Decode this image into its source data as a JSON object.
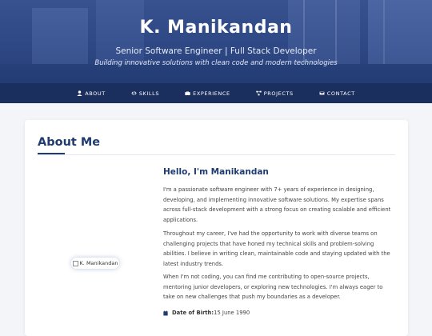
{
  "header": {
    "name": "K. Manikandan",
    "subtitle": "Senior Software Engineer | Full Stack Developer",
    "tagline": "Building innovative solutions with clean code and modern technologies"
  },
  "nav": {
    "items": [
      {
        "label": "ABOUT",
        "icon": "user-icon"
      },
      {
        "label": "SKILLS",
        "icon": "code-icon"
      },
      {
        "label": "EXPERIENCE",
        "icon": "briefcase-icon"
      },
      {
        "label": "PROJECTS",
        "icon": "project-diagram-icon"
      },
      {
        "label": "CONTACT",
        "icon": "envelope-icon"
      }
    ]
  },
  "about": {
    "section_title": "About Me",
    "photo_alt": "K. Manikandan",
    "greeting": "Hello, I'm Manikandan",
    "paragraphs": [
      "I'm a passionate software engineer with 7+ years of experience in designing, developing, and implementing innovative software solutions. My expertise spans across full-stack development with a strong focus on creating scalable and efficient applications.",
      "Throughout my career, I've had the opportunity to work with diverse teams on challenging projects that have honed my technical skills and problem-solving abilities. I believe in writing clean, maintainable code and staying updated with the latest industry trends.",
      "When I'm not coding, you can find me contributing to open-source projects, mentoring junior developers, or exploring new technologies. I'm always eager to take on new challenges that push my boundaries as a developer."
    ],
    "dob_label": "Date of Birth:",
    "dob_value": "15 June 1990"
  }
}
